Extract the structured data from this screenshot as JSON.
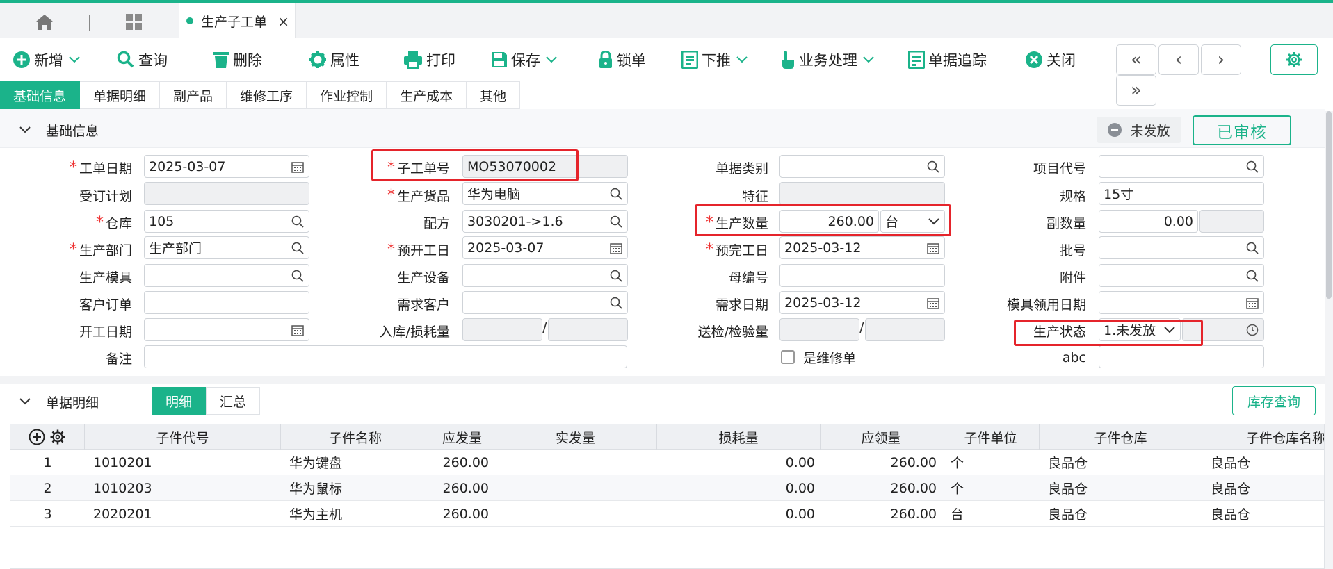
{
  "brand_color": "#1bb38a",
  "alert_color": "#e5242b",
  "tabs": {
    "home_icon": "home-icon",
    "grid_icon": "grid-icon",
    "active_tab": "生产子工单",
    "close": "×"
  },
  "toolbar": {
    "add": "新增",
    "query": "查询",
    "delete": "删除",
    "attributes": "属性",
    "print": "打印",
    "save": "保存",
    "lock": "锁单",
    "push_down": "下推",
    "business": "业务处理",
    "trace": "单据追踪",
    "close": "关闭",
    "first": "«",
    "prev": "‹",
    "next": "›",
    "last": "»"
  },
  "subtabs": [
    "基础信息",
    "单据明细",
    "副产品",
    "维修工序",
    "作业控制",
    "生产成本",
    "其他"
  ],
  "basic": {
    "section_title": "基础信息",
    "status_unissued": "未发放",
    "status_approved": "已审核",
    "fields": {
      "order_date": {
        "label": "工单日期",
        "value": "2025-03-07"
      },
      "sub_order_no": {
        "label": "子工单号",
        "value": "MO53070002"
      },
      "doc_type": {
        "label": "单据类别",
        "value": ""
      },
      "project_code": {
        "label": "项目代号",
        "value": ""
      },
      "order_plan": {
        "label": "受订计划",
        "value": ""
      },
      "product": {
        "label": "生产货品",
        "value": "华为电脑"
      },
      "feature": {
        "label": "特征",
        "value": ""
      },
      "spec": {
        "label": "规格",
        "value": "15寸"
      },
      "warehouse": {
        "label": "仓库",
        "value": "105"
      },
      "formula": {
        "label": "配方",
        "value": "3030201->1.6"
      },
      "qty": {
        "label": "生产数量",
        "value": "260.00",
        "unit": "台"
      },
      "sub_qty": {
        "label": "副数量",
        "value": "0.00"
      },
      "dept": {
        "label": "生产部门",
        "value": "生产部门"
      },
      "plan_start": {
        "label": "预开工日",
        "value": "2025-03-07"
      },
      "plan_end": {
        "label": "预完工日",
        "value": "2025-03-12"
      },
      "batch": {
        "label": "批号",
        "value": ""
      },
      "mold": {
        "label": "生产模具",
        "value": ""
      },
      "equipment": {
        "label": "生产设备",
        "value": ""
      },
      "parent_no": {
        "label": "母编号",
        "value": ""
      },
      "attachment": {
        "label": "附件",
        "value": ""
      },
      "cust_order": {
        "label": "客户订单",
        "value": ""
      },
      "demand_cust": {
        "label": "需求客户",
        "value": ""
      },
      "demand_date": {
        "label": "需求日期",
        "value": "2025-03-12"
      },
      "mold_date": {
        "label": "模具领用日期",
        "value": ""
      },
      "start_date": {
        "label": "开工日期",
        "value": ""
      },
      "inbound_loss": {
        "label": "入库/损耗量",
        "value": ""
      },
      "inspect_qty": {
        "label": "送检/检验量",
        "value": ""
      },
      "prod_status": {
        "label": "生产状态",
        "value": "1.未发放"
      },
      "remark": {
        "label": "备注",
        "value": ""
      },
      "is_repair": {
        "label": "是维修单"
      },
      "abc": {
        "label": "abc",
        "value": ""
      }
    }
  },
  "detail": {
    "section_title": "单据明细",
    "seg_detail": "明细",
    "seg_summary": "汇总",
    "stock_query": "库存查询",
    "columns": [
      "子件代号",
      "子件名称",
      "应发量",
      "实发量",
      "损耗量",
      "应领量",
      "子件单位",
      "子件仓库",
      "子件仓库名称"
    ],
    "rows": [
      {
        "no": "1",
        "code": "1010201",
        "name": "华为键盘",
        "should_issue": "260.00",
        "issued": "",
        "loss": "0.00",
        "should_receive": "260.00",
        "unit": "个",
        "wh": "良品仓",
        "wh_name": "良品仓"
      },
      {
        "no": "2",
        "code": "1010203",
        "name": "华为鼠标",
        "should_issue": "260.00",
        "issued": "",
        "loss": "0.00",
        "should_receive": "260.00",
        "unit": "个",
        "wh": "良品仓",
        "wh_name": "良品仓"
      },
      {
        "no": "3",
        "code": "2020201",
        "name": "华为主机",
        "should_issue": "260.00",
        "issued": "",
        "loss": "0.00",
        "should_receive": "260.00",
        "unit": "台",
        "wh": "良品仓",
        "wh_name": "良品仓"
      }
    ]
  }
}
